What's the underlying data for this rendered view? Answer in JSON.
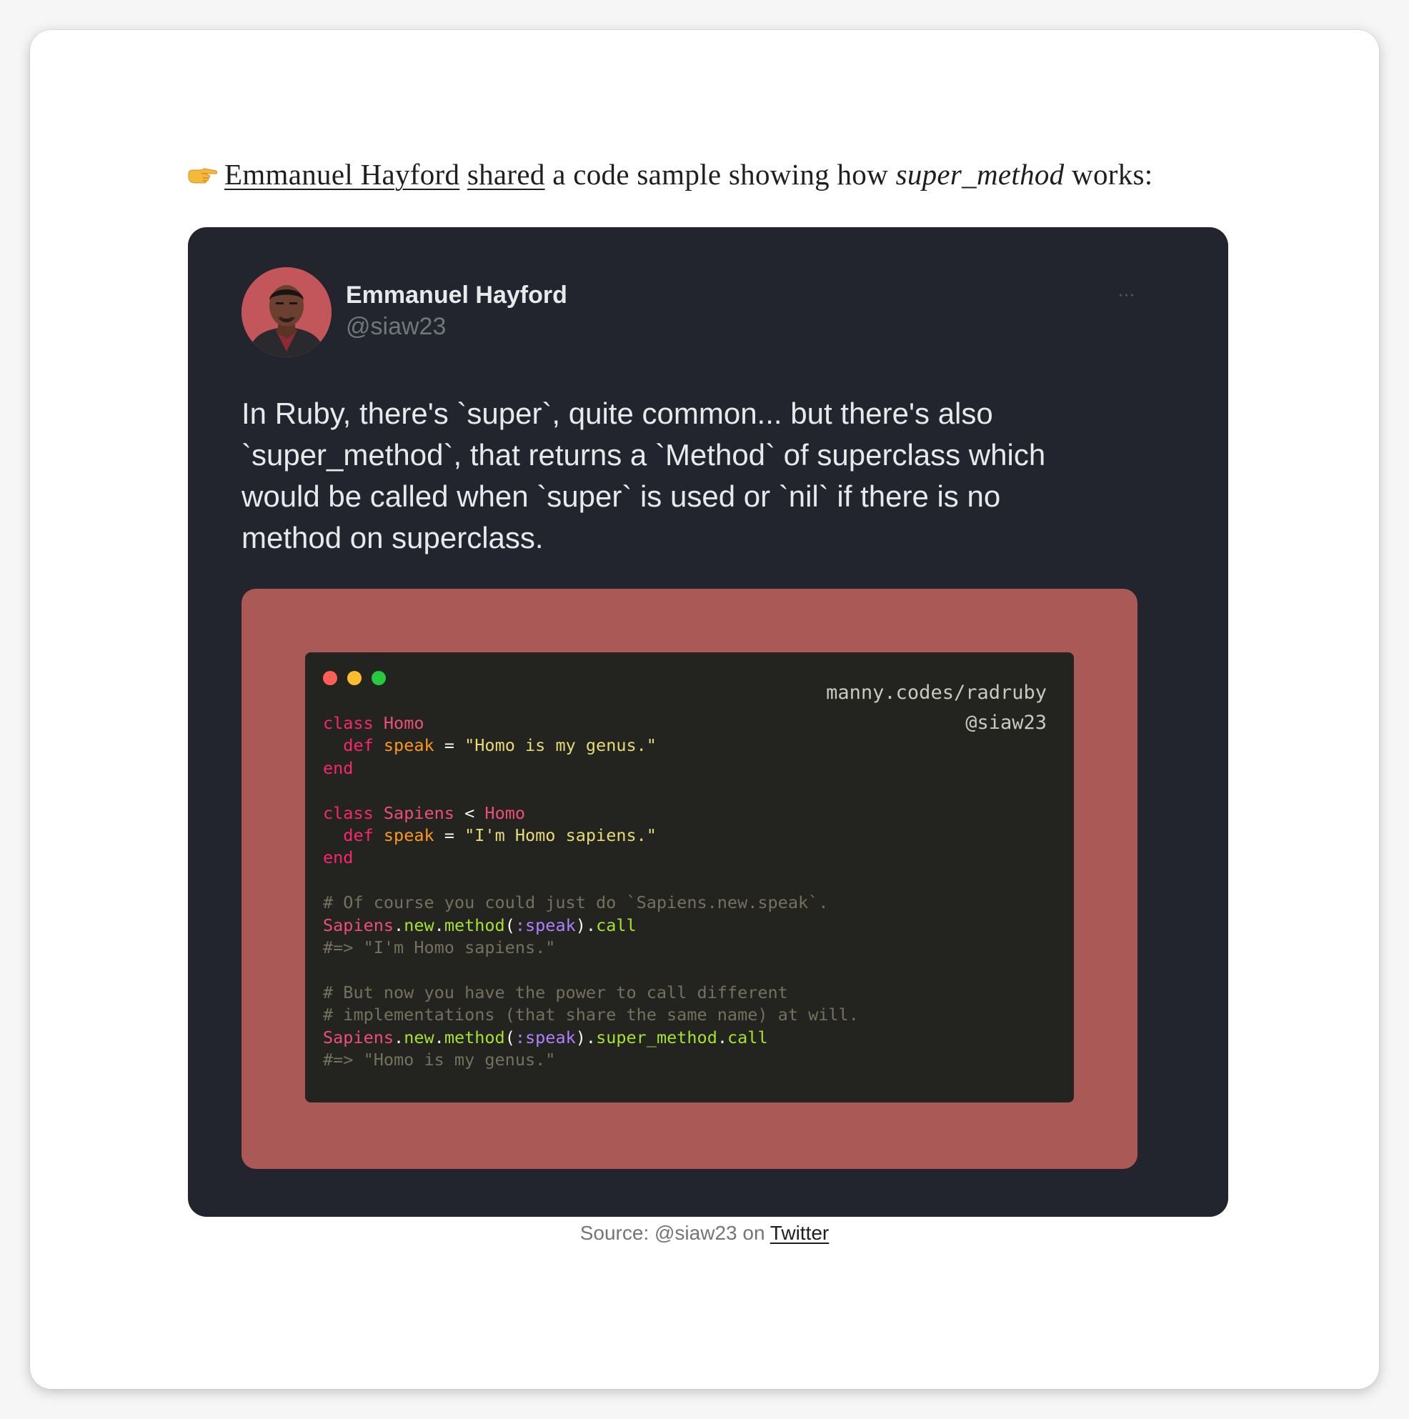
{
  "intro": {
    "icon": "backhand-index-pointing-right-icon",
    "author_link": "Emmanuel Hayford",
    "shared_link": "shared",
    "text_mid": " a code sample showing how ",
    "method_name": "super_method",
    "text_end": " works:"
  },
  "tweet": {
    "author_name": "Emmanuel Hayford",
    "author_handle": "@siaw23",
    "more_label": "···",
    "text": "In Ruby, there's `super`, quite common... but there's also\n`super_method`, that returns a `Method` of superclass which\nwould be called when `super` is used or `nil` if there is no\nmethod on superclass.",
    "media": {
      "background_color": "#ab5956",
      "watermark_line1": "manny.codes/radruby",
      "watermark_line2": "@siaw23",
      "code": {
        "kw_class": "class",
        "kw_def": "def",
        "kw_end": "end",
        "class_homo": "Homo",
        "class_sapiens": "Sapiens",
        "lt": "<",
        "method_speak": "speak",
        "eq": "=",
        "str_homo": "\"Homo is my genus.\"",
        "str_sapiens": "\"I'm Homo sapiens.\"",
        "comment1": "# Of course you could just do `Sapiens.new.speak`.",
        "call1_receiver": "Sapiens",
        "dot": ".",
        "new": "new",
        "method": "method",
        "open_paren": "(",
        "symbol": ":speak",
        "close_paren": ")",
        "call": "call",
        "result1": "#=> \"I'm Homo sapiens.\"",
        "comment2": "# But now you have the power to call different",
        "comment3": "# implementations (that share the same name) at will.",
        "super_method": "super_method",
        "result2": "#=> \"Homo is my genus.\""
      }
    }
  },
  "caption": {
    "prefix": "Source: @siaw23 on ",
    "link": "Twitter"
  }
}
